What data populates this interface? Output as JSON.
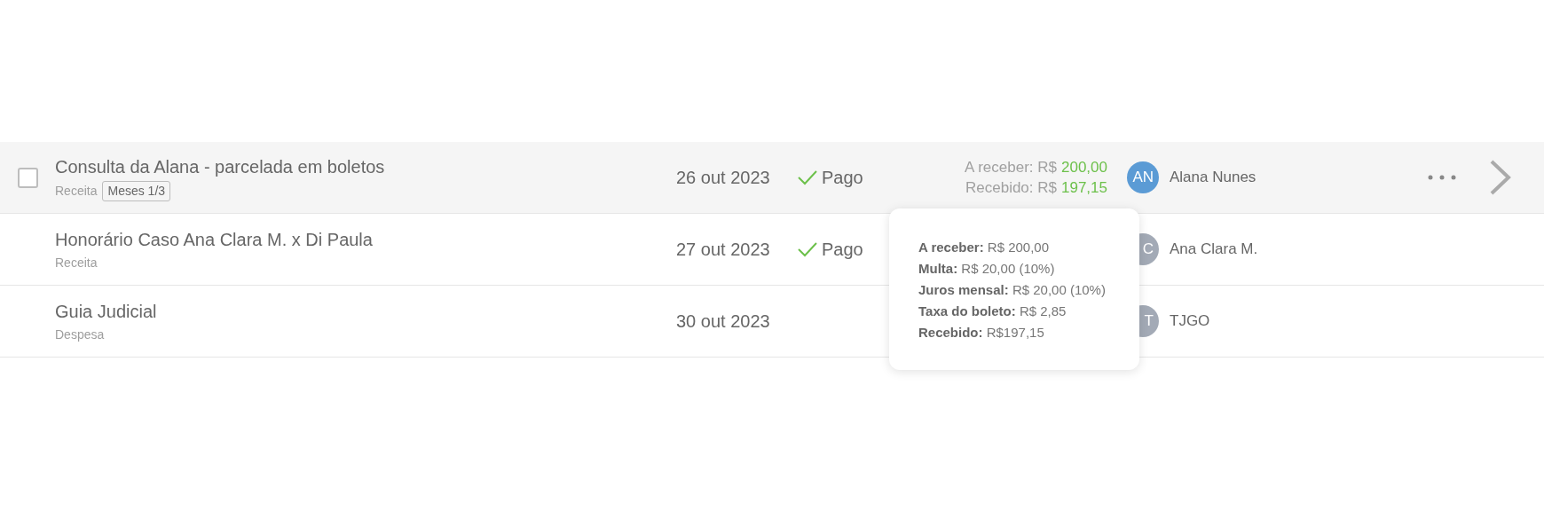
{
  "rows": [
    {
      "title": "Consulta da Alana - parcelada em boletos",
      "category": "Receita",
      "tag": "Meses 1/3",
      "date": "26 out 2023",
      "status": "Pago",
      "paid": true,
      "hovered": true,
      "checkbox": {
        "checked": false
      },
      "amounts": [
        {
          "label": "A receber: R$",
          "value": "200,00"
        },
        {
          "label": "Recebido: R$",
          "value": "197,15"
        }
      ],
      "avatar": {
        "initials": "AN",
        "color": "#5b9bd5"
      },
      "person": "Alana Nunes"
    },
    {
      "title": "Honorário Caso Ana Clara M. x Di Paula",
      "category": "Receita",
      "date": "27 out 2023",
      "status": "Pago",
      "paid": true,
      "hovered": false,
      "avatar": {
        "initials": "C",
        "color": "#a3aab6"
      },
      "person": "Ana Clara M."
    },
    {
      "title": "Guia Judicial",
      "category": "Despesa",
      "date": "30 out 2023",
      "paid": false,
      "hovered": false,
      "avatar": {
        "initials": "T",
        "color": "#a3aab6"
      },
      "person": "TJGO"
    }
  ],
  "tooltip": {
    "lines": [
      "**A receber:** R$ 200,00",
      "**Multa:** R$ 20,00 (10%)",
      "**Juros mensal:** R$ 20,00 (10%)",
      "**Taxa do boleto:** R$ 2,85",
      "**Recebido:** R$197,15"
    ]
  }
}
